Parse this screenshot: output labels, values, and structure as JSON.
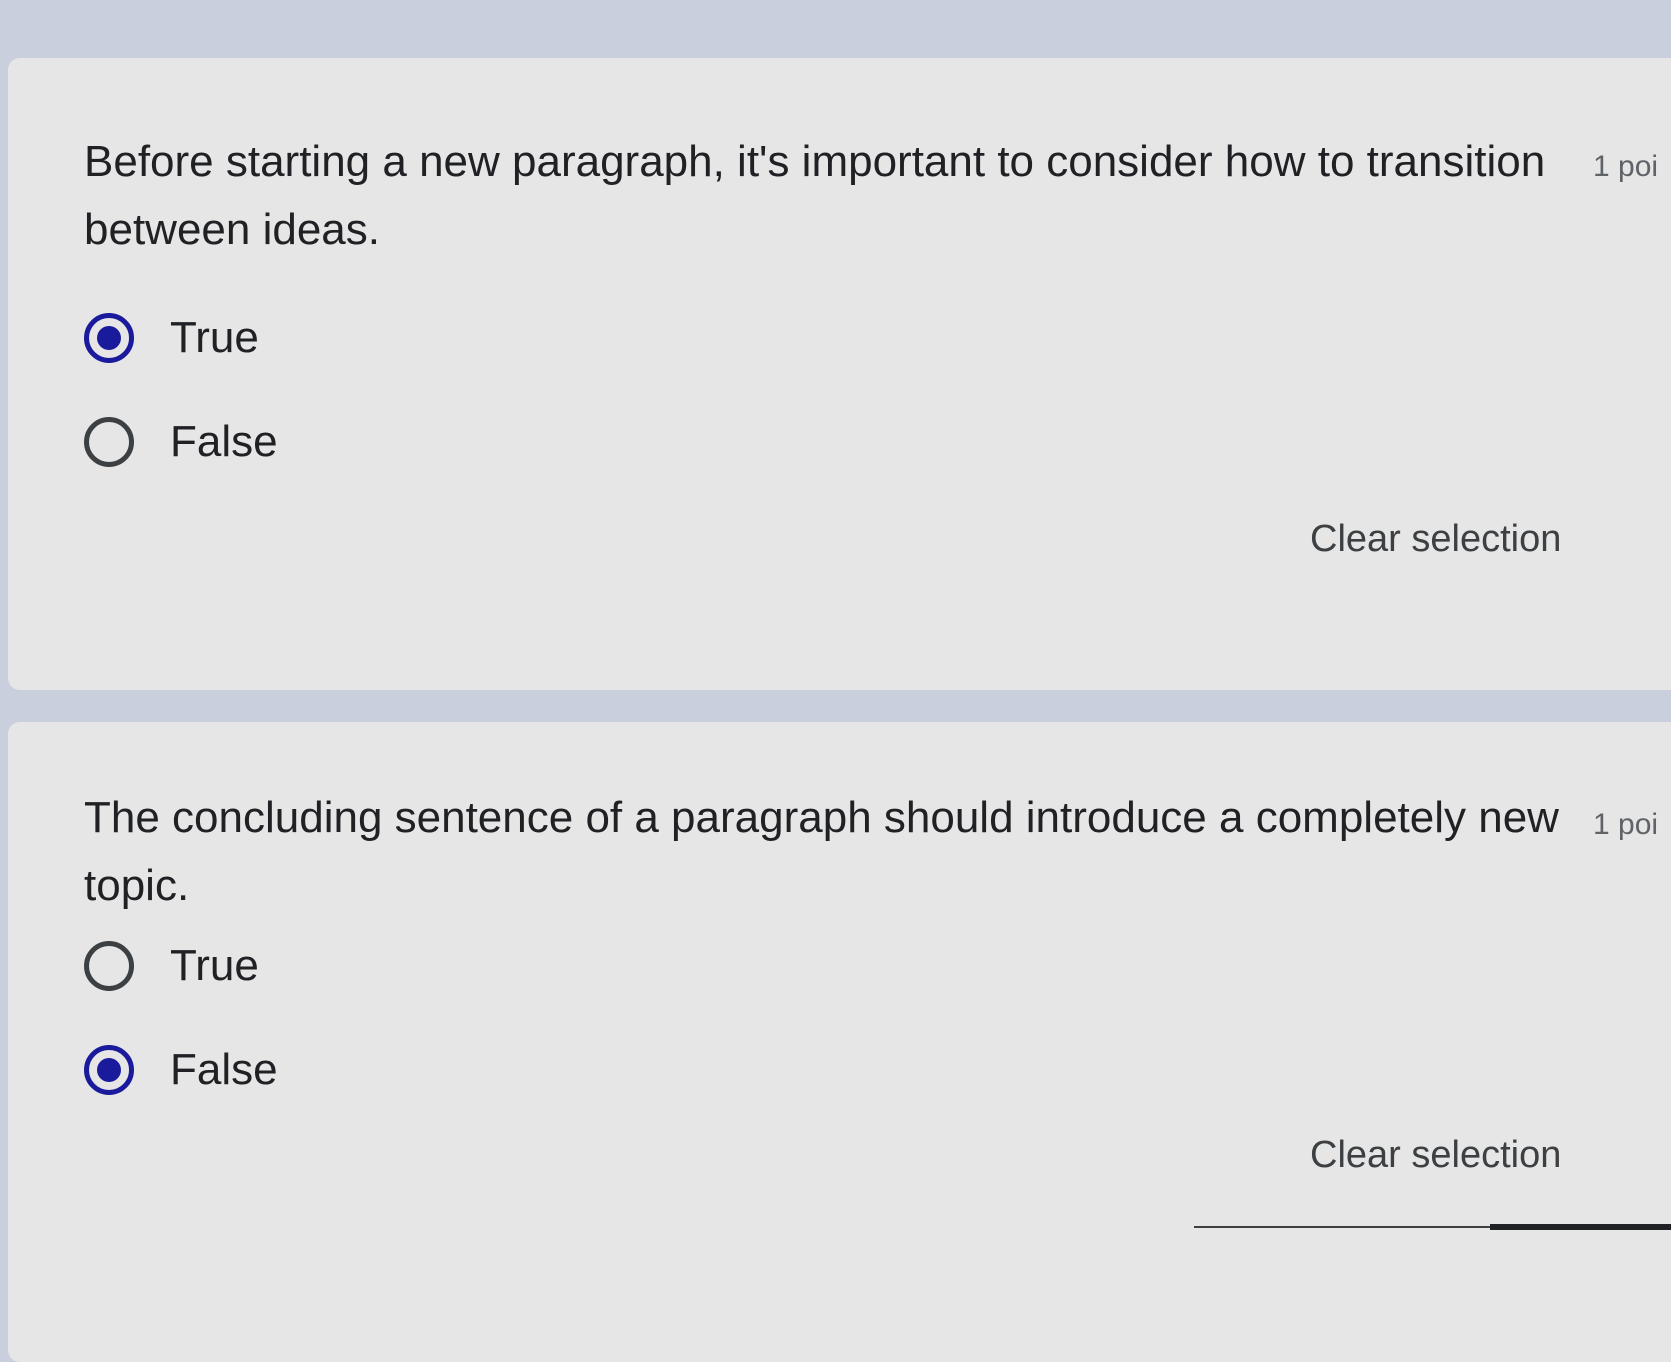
{
  "questions": [
    {
      "text": "Before starting a new paragraph, it's important to consider how to transition between ideas.",
      "points": "1 poi",
      "options": [
        {
          "label": "True",
          "selected": true
        },
        {
          "label": "False",
          "selected": false
        }
      ],
      "clear_label": "Clear selection"
    },
    {
      "text": "The concluding sentence of a paragraph should introduce a completely new topic.",
      "points": "1 poi",
      "options": [
        {
          "label": "True",
          "selected": false
        },
        {
          "label": "False",
          "selected": true
        }
      ],
      "clear_label": "Clear selection"
    }
  ],
  "colors": {
    "accent": "#1a1a9c",
    "card_background": "#e6e6e6",
    "page_background": "#c9cfdc"
  }
}
